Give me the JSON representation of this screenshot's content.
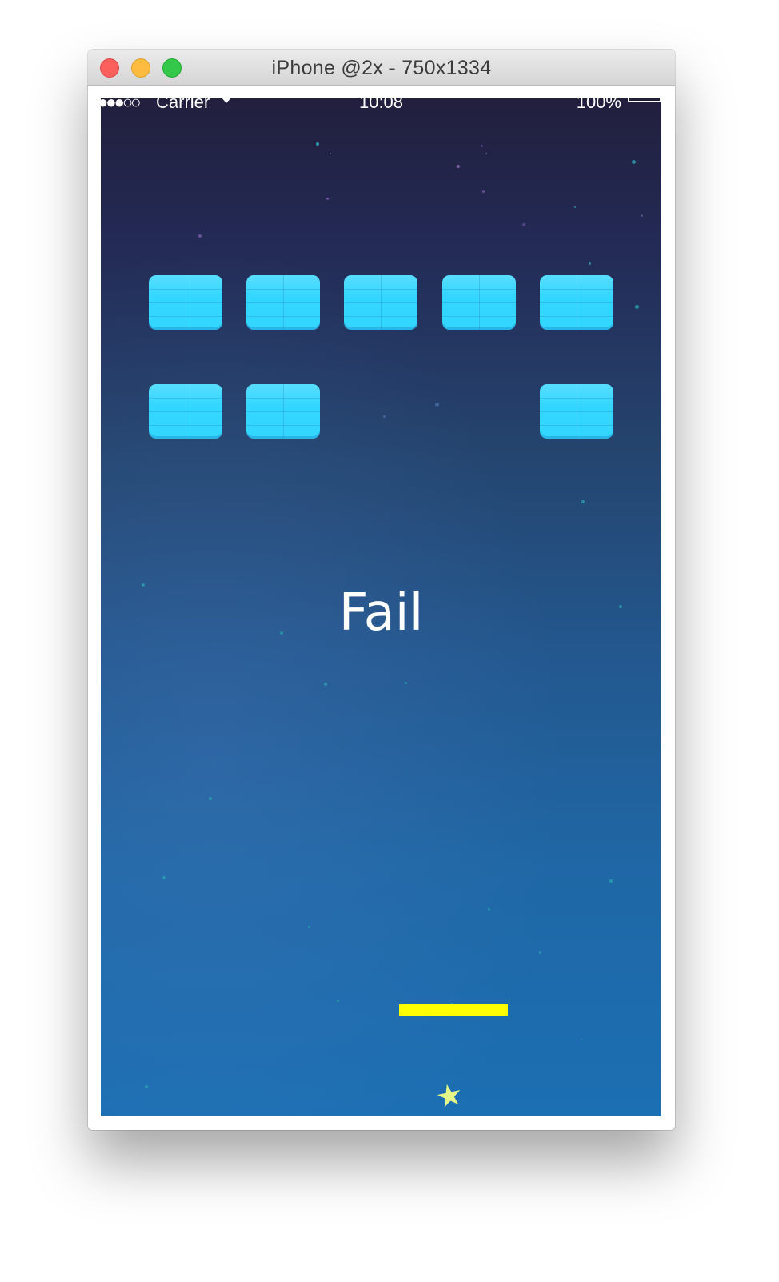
{
  "window": {
    "title": "iPhone @2x - 750x1334"
  },
  "status_bar": {
    "signal": "●●●○○",
    "carrier": "Carrier",
    "wifi_icon": "wifi-icon",
    "time": "10:08",
    "battery_percent": "100%"
  },
  "game": {
    "message": "Fail",
    "bricks": {
      "rows": 2,
      "columns": 5,
      "remaining": [
        [
          1,
          1,
          1,
          1,
          1
        ],
        [
          1,
          1,
          0,
          0,
          1
        ]
      ],
      "color": "#33d6ff"
    },
    "paddle_color": "#ffff00",
    "ball_icon": "star-icon",
    "ball_color": "#e4f58a"
  },
  "colors": {
    "sky_top": "#221f3d",
    "sky_bottom": "#1b6fb3"
  }
}
